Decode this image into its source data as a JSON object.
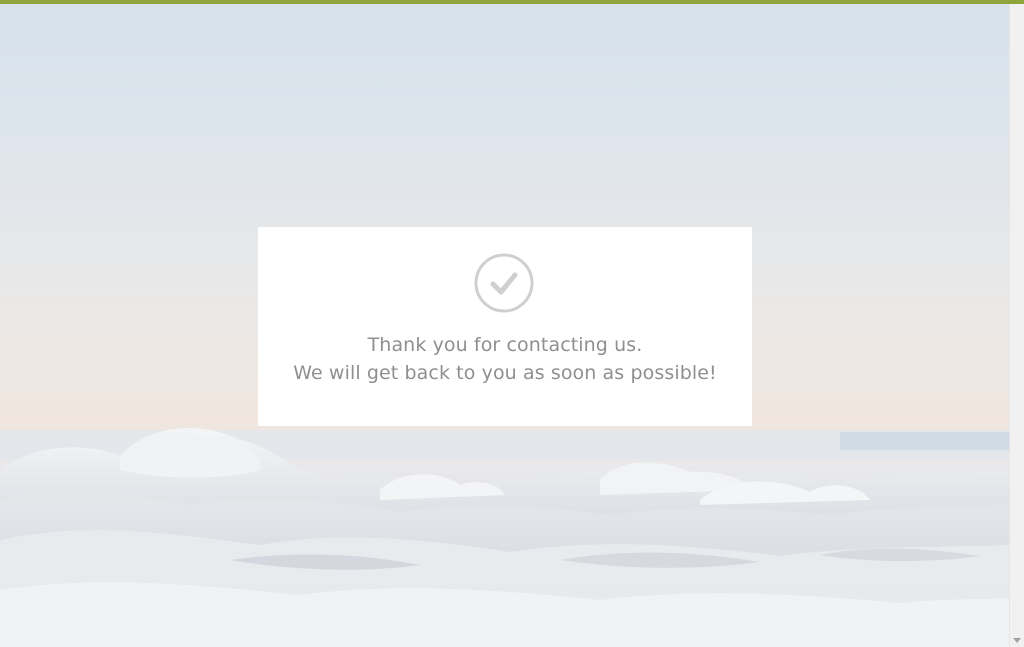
{
  "colors": {
    "top_bar": "#8fa43a",
    "card_background": "#ffffff",
    "message_text": "#8f8f8f",
    "check_icon": "#cfcfcf"
  },
  "background": {
    "icon": "clouds-above-mountains-image"
  },
  "confirmation": {
    "icon": "check-circle-icon",
    "line1": "Thank you for contacting us.",
    "line2": "We will get back to you as soon as possible!"
  },
  "scrollbar": {
    "icon": "scroll-down-arrow-icon"
  }
}
